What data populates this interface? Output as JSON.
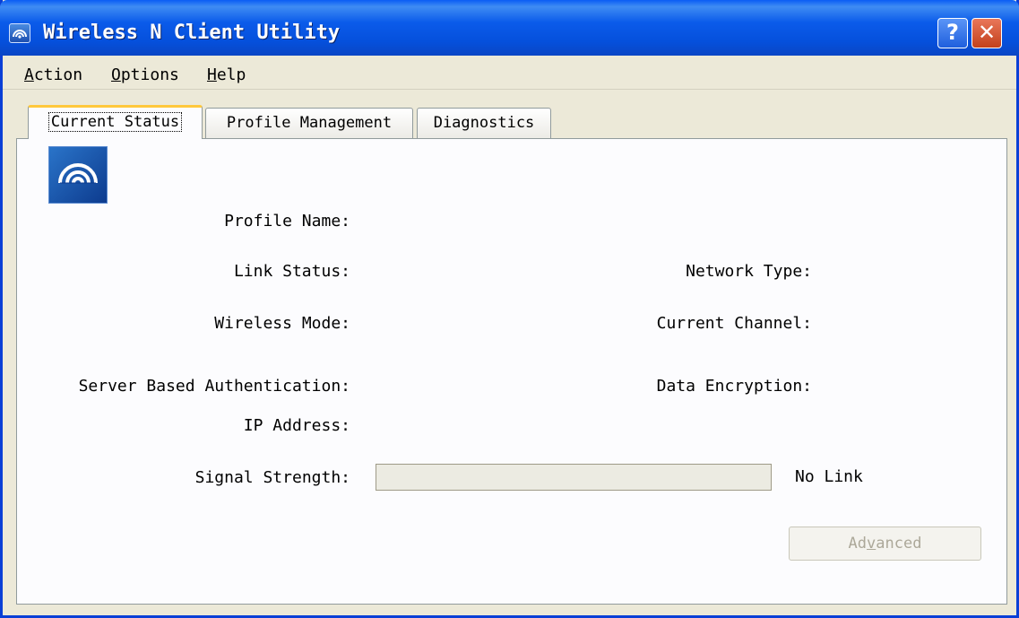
{
  "window": {
    "title": "Wireless N Client Utility",
    "help_label": "?",
    "close_label": "✕"
  },
  "menu": {
    "items": [
      {
        "mnemonic": "A",
        "rest": "ction"
      },
      {
        "mnemonic": "O",
        "rest": "ptions"
      },
      {
        "mnemonic": "H",
        "rest": "elp"
      }
    ]
  },
  "tabs": [
    {
      "label": "Current Status",
      "active": true
    },
    {
      "label": "Profile Management",
      "active": false
    },
    {
      "label": "Diagnostics",
      "active": false
    }
  ],
  "status": {
    "profile_name_label": "Profile Name:",
    "link_status_label": "Link Status:",
    "network_type_label": "Network Type:",
    "wireless_mode_label": "Wireless Mode:",
    "current_channel_label": "Current Channel:",
    "server_auth_label": "Server Based Authentication:",
    "data_encryption_label": "Data Encryption:",
    "ip_address_label": "IP Address:",
    "signal_strength_label": "Signal Strength:",
    "signal_strength_fraction": 0,
    "signal_text": "No Link"
  },
  "advanced_button": {
    "before": "Ad",
    "mnemonic": "v",
    "after": "anced",
    "enabled": false
  },
  "icons": {
    "app": "wireless-signal-icon",
    "status": "wireless-signal-icon"
  },
  "colors": {
    "titlebar": "#0553dc",
    "tab_highlight": "#ffc83c",
    "window_bg": "#ece9d8"
  }
}
